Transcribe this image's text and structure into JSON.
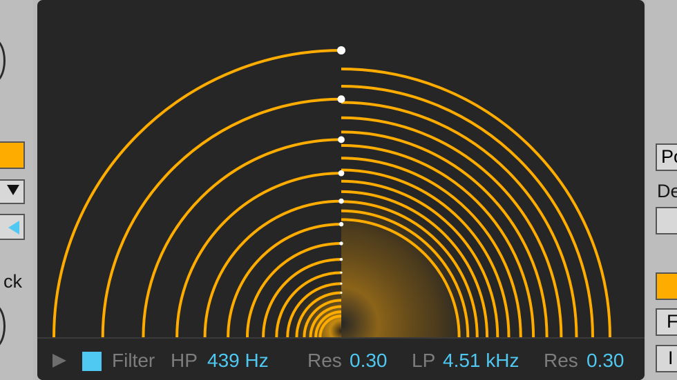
{
  "left_panel": {
    "label_partial": "ck"
  },
  "right_panel": {
    "button_partial": "Po",
    "label_partial": "De",
    "button2_partial": "F",
    "button3_partial": "I"
  },
  "colors": {
    "accent": "#ffac00",
    "value_blue": "#4fc8f2",
    "label_grey": "#7d7d7d",
    "background": "#262626"
  },
  "bottom_bar": {
    "play_icon": "play-triangle",
    "filter_label": "Filter",
    "hp_label": "HP",
    "hp_value": "439 Hz",
    "res1_label": "Res",
    "res1_value": "0.30",
    "lp_label": "LP",
    "lp_value": "4.51 kHz",
    "res2_label": "Res",
    "res2_value": "0.30"
  }
}
